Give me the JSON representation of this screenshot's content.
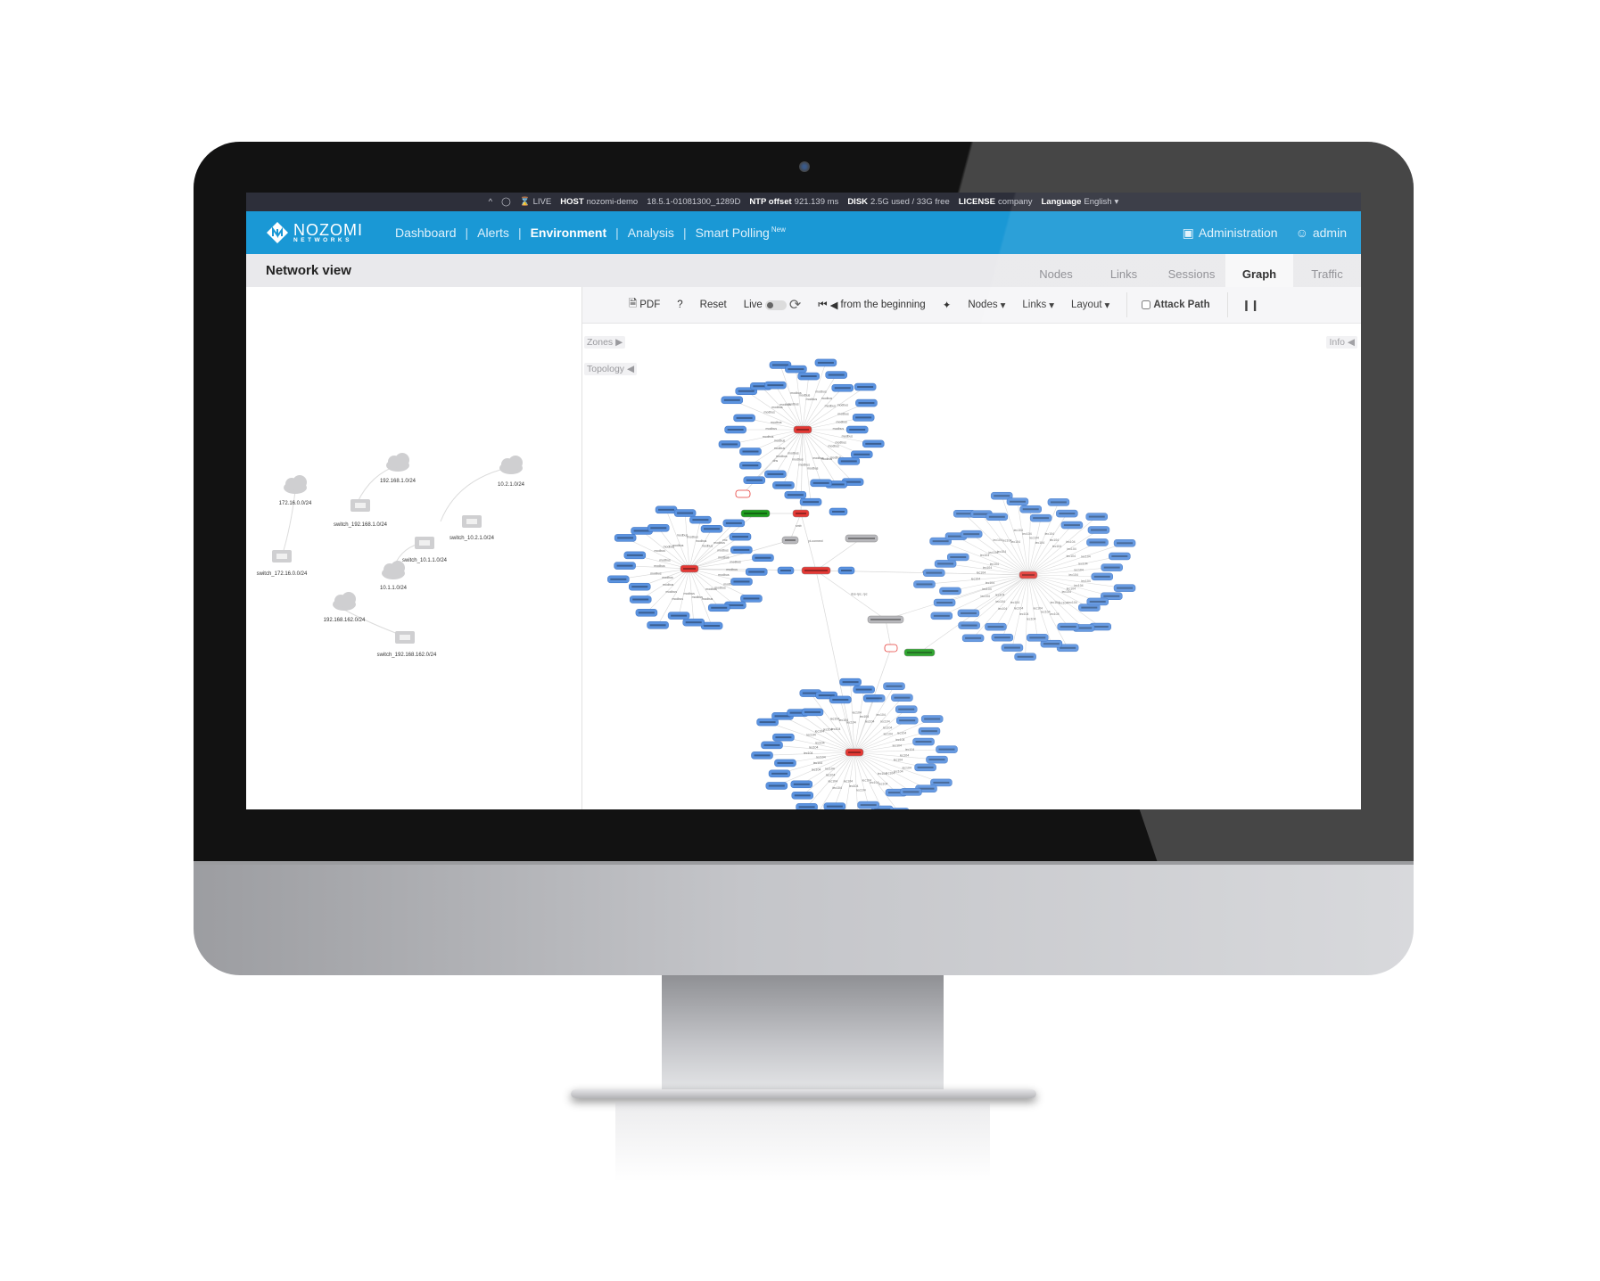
{
  "statusbar": {
    "live_label": "LIVE",
    "host_label": "HOST",
    "host_value": "nozomi-demo",
    "version": "18.5.1-01081300_1289D",
    "ntp_label": "NTP offset",
    "ntp_value": "921.139 ms",
    "disk_label": "DISK",
    "disk_value": "2.5G used / 33G free",
    "license_label": "LICENSE",
    "license_value": "company",
    "language_label": "Language",
    "language_value": "English"
  },
  "brand": {
    "name_line1": "NOZOMI",
    "name_line2": "NETWORKS",
    "color": "#1a98d5"
  },
  "nav": {
    "items": [
      {
        "label": "Dashboard",
        "active": false
      },
      {
        "label": "Alerts",
        "active": false
      },
      {
        "label": "Environment",
        "active": true
      },
      {
        "label": "Analysis",
        "active": false
      },
      {
        "label": "Smart Polling",
        "active": false,
        "badge": "New"
      }
    ],
    "administration": "Administration",
    "user": "admin"
  },
  "page": {
    "title": "Network view",
    "tabs": [
      {
        "label": "Nodes",
        "active": false
      },
      {
        "label": "Links",
        "active": false
      },
      {
        "label": "Sessions",
        "active": false
      },
      {
        "label": "Graph",
        "active": true
      },
      {
        "label": "Traffic",
        "active": false
      }
    ]
  },
  "toolbar": {
    "pdf": "PDF",
    "help": "?",
    "reset": "Reset",
    "live": "Live",
    "from_beginning": "from the beginning",
    "nodes": "Nodes",
    "links": "Links",
    "layout": "Layout",
    "attack_path": "Attack Path",
    "live_enabled": false,
    "attack_path_checked": false
  },
  "graph_panels": {
    "zones": "Zones",
    "topology": "Topology",
    "info": "Info"
  },
  "topology": {
    "subnets": [
      {
        "name": "172.16.0.0/24",
        "switch": "switch_172.16.0.0/24"
      },
      {
        "name": "192.168.1.0/24",
        "switch": "switch_192.168.1.0/24"
      },
      {
        "name": "10.2.1.0/24",
        "switch": "switch_10.2.1.0/24"
      },
      {
        "name": "10.1.1.0/24",
        "switch": "switch_10.1.1.0/24"
      },
      {
        "name": "192.168.162.0/24",
        "switch": "switch_192.168.162.0/24"
      }
    ]
  },
  "graph": {
    "colors": {
      "node": "#5b93e0",
      "hub": "#e53935",
      "gateway": "#1f9d1f",
      "neutral": "#b8b8bc",
      "edge": "#d8d8d8"
    },
    "clusters": [
      {
        "name": "top",
        "protocol": "modbus",
        "leaves": 30
      },
      {
        "name": "left",
        "protocol": "modbus",
        "leaves": 26
      },
      {
        "name": "right",
        "protocol": "iec104",
        "leaves": 44
      },
      {
        "name": "bottom",
        "protocol": "iec104",
        "leaves": 40
      }
    ],
    "inter_protocols": [
      "dns",
      "vnc",
      "smb",
      "pi-connect",
      "ethernetip",
      "dce-rpc, rpc"
    ]
  }
}
